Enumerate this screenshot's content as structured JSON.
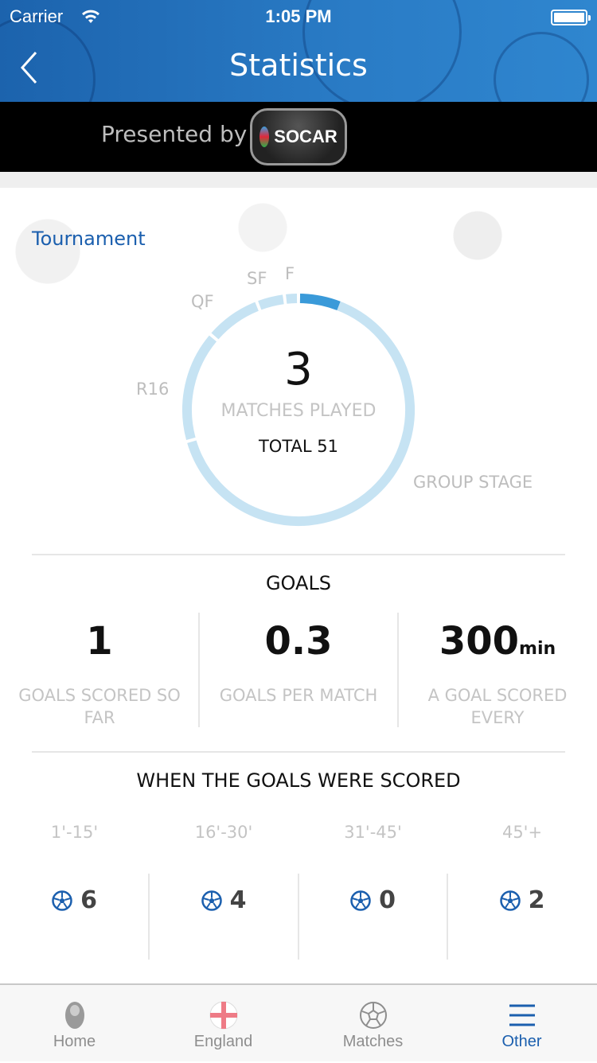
{
  "status_bar": {
    "carrier": "Carrier",
    "time": "1:05 PM"
  },
  "nav": {
    "title": "Statistics",
    "back_icon": "chevron-left-icon"
  },
  "sponsor": {
    "presented_by": "Presented by",
    "brand": "SOCAR"
  },
  "tournament": {
    "heading": "Tournament",
    "matches_played": "3",
    "matches_played_label": "MATCHES PLAYED",
    "total_label": "TOTAL 51",
    "played_value": 3,
    "stages": [
      {
        "label": "GROUP STAGE",
        "matches": 36
      },
      {
        "label": "R16",
        "matches": 8
      },
      {
        "label": "QF",
        "matches": 4
      },
      {
        "label": "SF",
        "matches": 2
      },
      {
        "label": "F",
        "matches": 1
      }
    ],
    "colors": {
      "played": "#3a9ad9",
      "remaining": "#c6e3f3"
    }
  },
  "goals": {
    "heading": "GOALS",
    "items": [
      {
        "value": "1",
        "unit": "",
        "label": "GOALS SCORED SO FAR"
      },
      {
        "value": "0.3",
        "unit": "",
        "label": "GOALS PER MATCH"
      },
      {
        "value": "300",
        "unit": "min",
        "label": "A GOAL SCORED EVERY"
      }
    ]
  },
  "goal_times": {
    "heading": "WHEN THE GOALS WERE SCORED",
    "icon": "soccer-ball-icon",
    "items": [
      {
        "range": "1'-15'",
        "count": "6"
      },
      {
        "range": "16'-30'",
        "count": "4"
      },
      {
        "range": "31'-45'",
        "count": "0"
      },
      {
        "range": "45'+",
        "count": "2"
      }
    ]
  },
  "tabbar": {
    "items": [
      {
        "label": "Home",
        "icon": "trophy-icon"
      },
      {
        "label": "England",
        "icon": "england-flag-icon"
      },
      {
        "label": "Matches",
        "icon": "soccer-ball-icon"
      },
      {
        "label": "Other",
        "icon": "menu-icon",
        "active": true
      }
    ],
    "active_color": "#1b5fae"
  }
}
